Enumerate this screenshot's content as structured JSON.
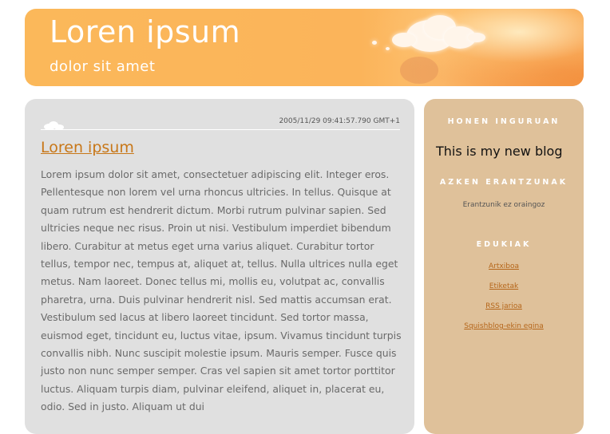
{
  "header": {
    "title": "Loren ipsum",
    "description": "dolor sit amet"
  },
  "post": {
    "timestamp": "2005/11/29 09:41:57.790 GMT+1",
    "title": "Loren ipsum",
    "body": "Lorem ipsum dolor sit amet, consectetuer adipiscing elit. Integer eros. Pellentesque non lorem vel urna rhoncus ultricies. In tellus. Quisque at quam rutrum est hendrerit dictum. Morbi rutrum pulvinar sapien. Sed ultricies neque nec risus. Proin ut nisi. Vestibulum imperdiet bibendum libero. Curabitur at metus eget urna varius aliquet. Curabitur tortor tellus, tempor nec, tempus at, aliquet at, tellus. Nulla ultrices nulla eget metus. Nam laoreet. Donec tellus mi, mollis eu, volutpat ac, convallis pharetra, urna. Duis pulvinar hendrerit nisl. Sed mattis accumsan erat. Vestibulum sed lacus at libero laoreet tincidunt. Sed tortor massa, euismod eget, tincidunt eu, luctus vitae, ipsum. Vivamus tincidunt turpis convallis nibh. Nunc suscipit molestie ipsum. Mauris semper. Fusce quis justo non nunc semper semper. Cras vel sapien sit amet tortor porttitor luctus. Aliquam turpis diam, pulvinar eleifend, aliquet in, placerat eu, odio. Sed in justo. Aliquam ut dui"
  },
  "sidebar": {
    "about_heading": "HONEN INGURUAN",
    "about_text": "This is my new blog",
    "comments_heading": "AZKEN ERANTZUNAK",
    "comments_text": "Erantzunik ez oraingoz",
    "content_heading": "EDUKIAK",
    "links": [
      "Artxiboa",
      "Etiketak",
      "RSS jarioa",
      "Squishblog-ekin egina"
    ]
  },
  "colors": {
    "header_orange": "#fbb85a",
    "post_title": "#c87718",
    "sidebar_bg": "#dfc19a",
    "main_bg": "#e0e0e0",
    "link": "#b5661a"
  }
}
